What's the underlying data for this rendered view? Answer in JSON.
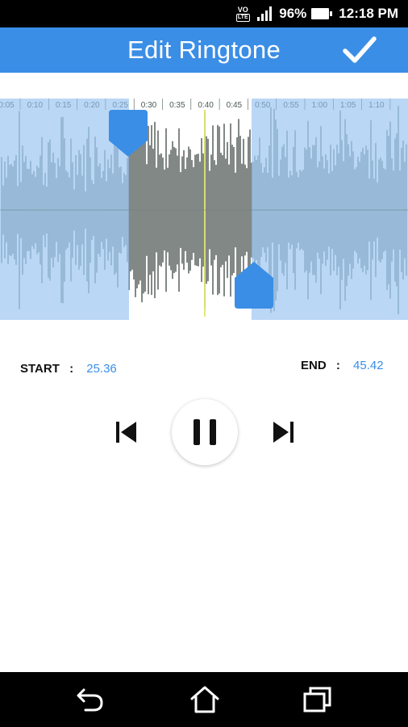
{
  "status_bar": {
    "volte_top": "VO",
    "volte_bottom": "LTE",
    "battery": "96%",
    "time": "12:18 PM",
    "icons": [
      "volte-icon",
      "signal-icon",
      "battery-icon"
    ]
  },
  "app_bar": {
    "title": "Edit Ringtone",
    "confirm_icon": "check-icon",
    "background": "#3a8ee6"
  },
  "timeline": {
    "ticks": [
      "0:05",
      "0:10",
      "0:15",
      "0:20",
      "0:25",
      "0:30",
      "0:35",
      "0:40",
      "0:45",
      "0:50",
      "0:55",
      "1:00",
      "1:05",
      "1:10"
    ],
    "selection_start": "25.36",
    "selection_end": "45.42"
  },
  "labels": {
    "start": "START",
    "end": "END",
    "colon": ":"
  },
  "values": {
    "start": "25.36",
    "end": "45.42"
  },
  "controls": {
    "previous": "skip-previous-icon",
    "pause": "pause-icon",
    "next": "skip-next-icon"
  },
  "navigation": {
    "back": "back-icon",
    "home": "home-icon",
    "recents": "recents-icon"
  },
  "colors": {
    "accent": "#3a8ee6",
    "selection_mask": "#8fbff0",
    "wave_selected": "#2f3a36",
    "wave_unselected": "#6b7f7a",
    "playhead": "#d8e04a"
  }
}
